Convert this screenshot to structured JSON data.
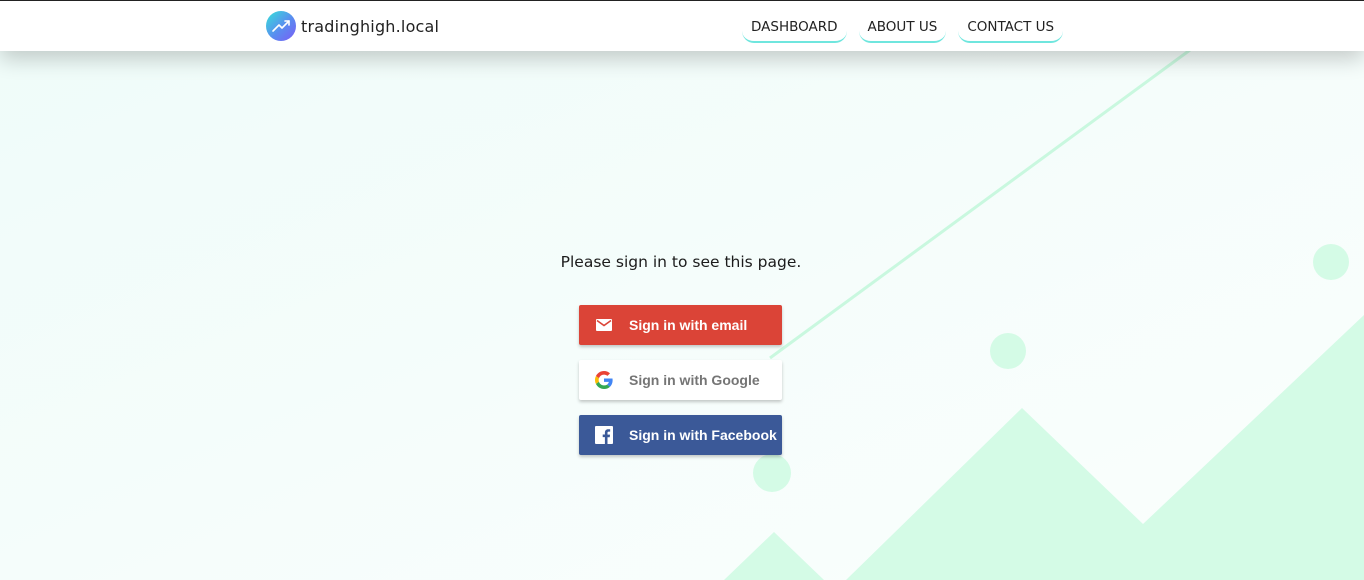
{
  "header": {
    "brand_name": "tradinghigh.local",
    "nav": [
      {
        "label": "DASHBOARD"
      },
      {
        "label": "ABOUT US"
      },
      {
        "label": "CONTACT US"
      }
    ]
  },
  "main": {
    "prompt": "Please sign in to see this page.",
    "buttons": {
      "email": {
        "label": "Sign in with email",
        "icon": "mail-icon",
        "color": "#db4437"
      },
      "google": {
        "label": "Sign in with Google",
        "icon": "google-icon",
        "color": "#ffffff"
      },
      "facebook": {
        "label": "Sign in with Facebook",
        "icon": "facebook-icon",
        "color": "#3b5998"
      }
    }
  },
  "theme": {
    "accent": "#6fe6de",
    "background": "#f5fdfb",
    "decor_green": "#d4fbe6"
  }
}
